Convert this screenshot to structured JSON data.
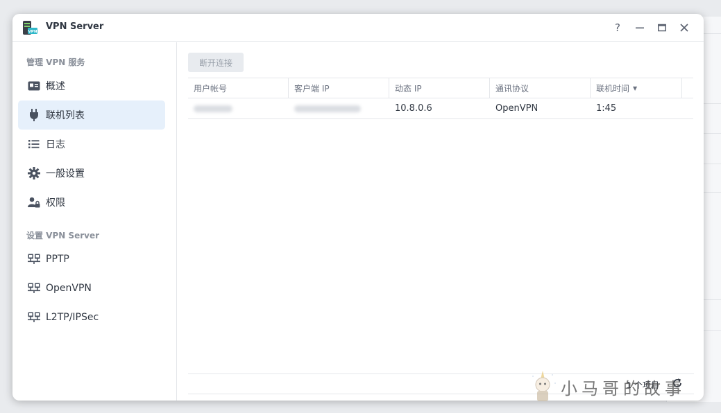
{
  "window": {
    "title": "VPN Server",
    "controls": {
      "help": "?",
      "minimize": "—",
      "maximize": "▭",
      "close": "✕"
    }
  },
  "sidebar": {
    "section1_title": "管理 VPN 服务",
    "section1_items": [
      {
        "label": "概述",
        "icon": "overview-card-icon"
      },
      {
        "label": "联机列表",
        "icon": "plug-icon"
      },
      {
        "label": "日志",
        "icon": "list-icon"
      },
      {
        "label": "一般设置",
        "icon": "gear-icon"
      },
      {
        "label": "权限",
        "icon": "user-lock-icon"
      }
    ],
    "section2_title": "设置 VPN Server",
    "section2_items": [
      {
        "label": "PPTP",
        "icon": "network-icon"
      },
      {
        "label": "OpenVPN",
        "icon": "network-icon"
      },
      {
        "label": "L2TP/IPSec",
        "icon": "network-icon"
      }
    ],
    "active_index": 1
  },
  "toolbar": {
    "disconnect_label": "断开连接"
  },
  "table": {
    "columns": [
      "用户帐号",
      "客户端 IP",
      "动态 IP",
      "通讯协议",
      "联机时间"
    ],
    "sorted_column": "联机时间",
    "rows": [
      {
        "user": "",
        "client_ip": "",
        "dynamic_ip": "10.8.0.6",
        "protocol": "OpenVPN",
        "time": "1:45"
      }
    ]
  },
  "footer": {
    "item_count": "1 个项目"
  },
  "watermark": {
    "text": "小马哥的故事"
  },
  "colors": {
    "accent": "#2f7fd3",
    "active_bg": "#e6f0fb",
    "icon": "#4a5260"
  }
}
